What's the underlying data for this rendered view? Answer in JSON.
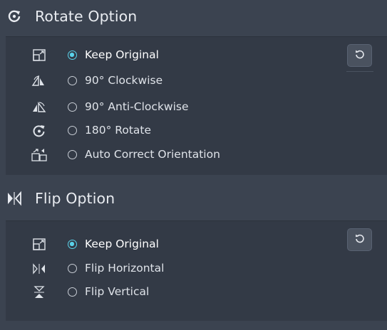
{
  "rotate": {
    "title": "Rotate Option",
    "icon": "rotate-icon",
    "options": [
      {
        "label": "Keep Original",
        "icon": "keep-original-icon",
        "selected": true
      },
      {
        "label": "90° Clockwise",
        "icon": "rotate-clockwise-icon",
        "selected": false
      },
      {
        "label": "90° Anti-Clockwise",
        "icon": "rotate-anticlockwise-icon",
        "selected": false
      },
      {
        "label": "180° Rotate",
        "icon": "rotate-180-icon",
        "selected": false
      },
      {
        "label": "Auto Correct Orientation",
        "icon": "auto-correct-icon",
        "selected": false
      }
    ],
    "reset_icon": "reset-icon"
  },
  "flip": {
    "title": "Flip Option",
    "icon": "flip-icon",
    "options": [
      {
        "label": "Keep Original",
        "icon": "keep-original-icon",
        "selected": true
      },
      {
        "label": "Flip Horizontal",
        "icon": "flip-horizontal-icon",
        "selected": false
      },
      {
        "label": "Flip Vertical",
        "icon": "flip-vertical-icon",
        "selected": false
      }
    ],
    "reset_icon": "reset-icon"
  },
  "colors": {
    "background": "#3b4350",
    "panel": "#333a46",
    "accent": "#5ad2ea",
    "text": "#e6e9ee"
  }
}
